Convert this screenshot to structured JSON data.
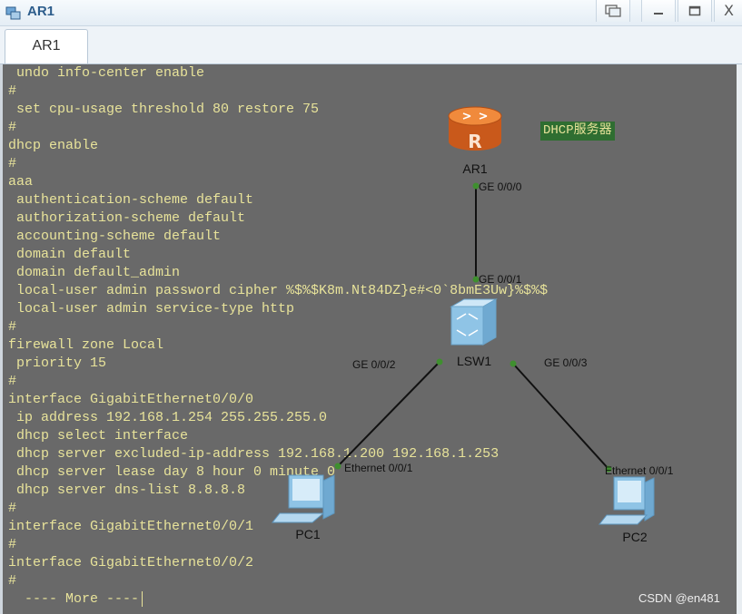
{
  "window": {
    "title": "AR1",
    "close_glyph": "X"
  },
  "tabs": [
    {
      "label": "AR1",
      "active": true
    }
  ],
  "console": {
    "lines": [
      " undo info-center enable",
      "#",
      " set cpu-usage threshold 80 restore 75",
      "#",
      "dhcp enable",
      "#",
      "aaa",
      " authentication-scheme default",
      " authorization-scheme default",
      " accounting-scheme default",
      " domain default",
      " domain default_admin",
      " local-user admin password cipher %$%$K8m.Nt84DZ}e#<0`8bmE3Uw}%$%$",
      " local-user admin service-type http",
      "#",
      "firewall zone Local",
      " priority 15",
      "#",
      "interface GigabitEthernet0/0/0",
      " ip address 192.168.1.254 255.255.255.0",
      " dhcp select interface",
      " dhcp server excluded-ip-address 192.168.1.200 192.168.1.253",
      " dhcp server lease day 8 hour 0 minute 0",
      " dhcp server dns-list 8.8.8.8",
      "#",
      "interface GigabitEthernet0/0/1",
      "#",
      "interface GigabitEthernet0/0/2",
      "#",
      "  ---- More ----"
    ]
  },
  "topology": {
    "note": "DHCP服务器",
    "devices": {
      "router": "AR1",
      "switch": "LSW1",
      "pc1": "PC1",
      "pc2": "PC2"
    },
    "ports": {
      "ar1_ge000": "GE 0/0/0",
      "lsw1_ge001": "GE 0/0/1",
      "lsw1_ge002": "GE 0/0/2",
      "lsw1_ge003": "GE 0/0/3",
      "pc1_eth": "Ethernet 0/0/1",
      "pc2_eth": "Ethernet 0/0/1"
    }
  },
  "watermark": "CSDN @en481",
  "colors": {
    "console_bg": "#696969",
    "console_text": "#e8e39a",
    "router": "#e8782a",
    "switch": "#8fc4e6",
    "link_dot": "#3f8f2f",
    "note_bg": "#2f6e31"
  }
}
